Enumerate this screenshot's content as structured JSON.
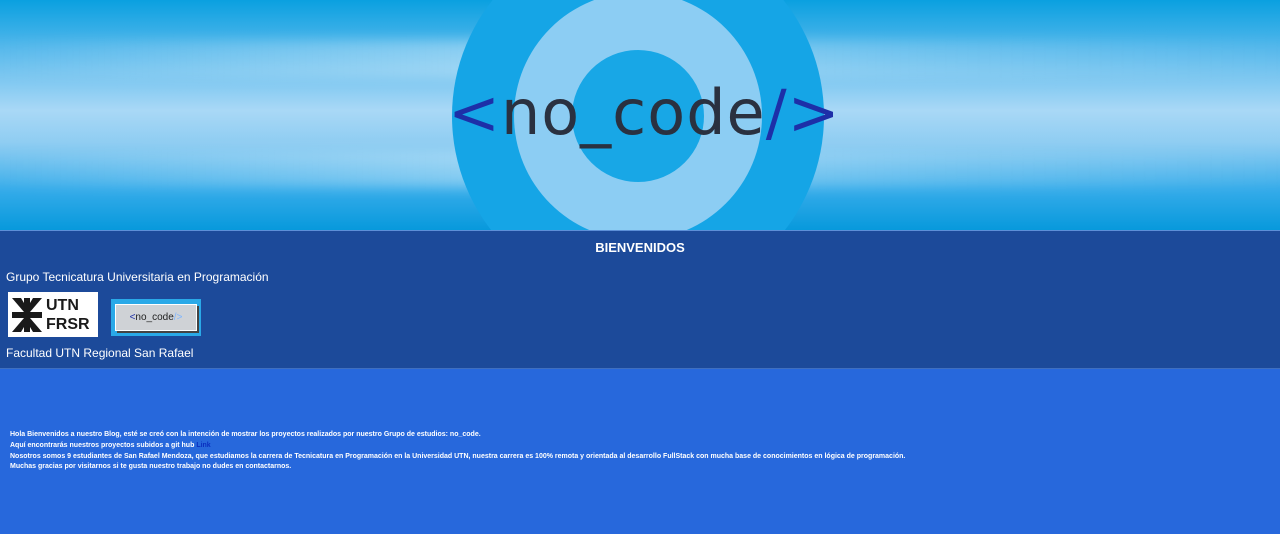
{
  "hero": {
    "logo_open": "<",
    "logo_word": "no_code",
    "logo_close": "/>"
  },
  "band": {
    "title": "BIENVENIDOS",
    "group_text": "Grupo Tecnicatura Universitaria en Programación",
    "utn_logo_line1": "UTN",
    "utn_logo_line2": "FRSR",
    "badge_open": "<",
    "badge_word": "no_code",
    "badge_close": "/>",
    "faculty_text": "Facultad UTN Regional San Rafael"
  },
  "content": {
    "line1": "Hola Bienvenidos a nuestro Blog, esté se creó con la intención de mostrar los proyectos realizados por nuestro Grupo de estudios: no_code.",
    "line2_prefix": "Aquí encontrarás nuestros proyectos subidos a git hub ",
    "line2_link": "Link",
    "line3": "Nosotros somos 9 estudiantes de San Rafael Mendoza, que estudiamos la carrera de Tecnicatura en Programación en la Universidad UTN, nuestra carrera es 100% remota y orientada al desarrollo FullStack con mucha base de conocimientos en lógica de programación.",
    "line4": "Muchas gracias por visitarnos si te gusta nuestro trabajo no dudes en contactarnos."
  },
  "colors": {
    "band_bg": "#1c4a9a",
    "page_bg": "#2768dc",
    "logo_bracket": "#1d2fa8",
    "logo_text": "#2a3140"
  }
}
